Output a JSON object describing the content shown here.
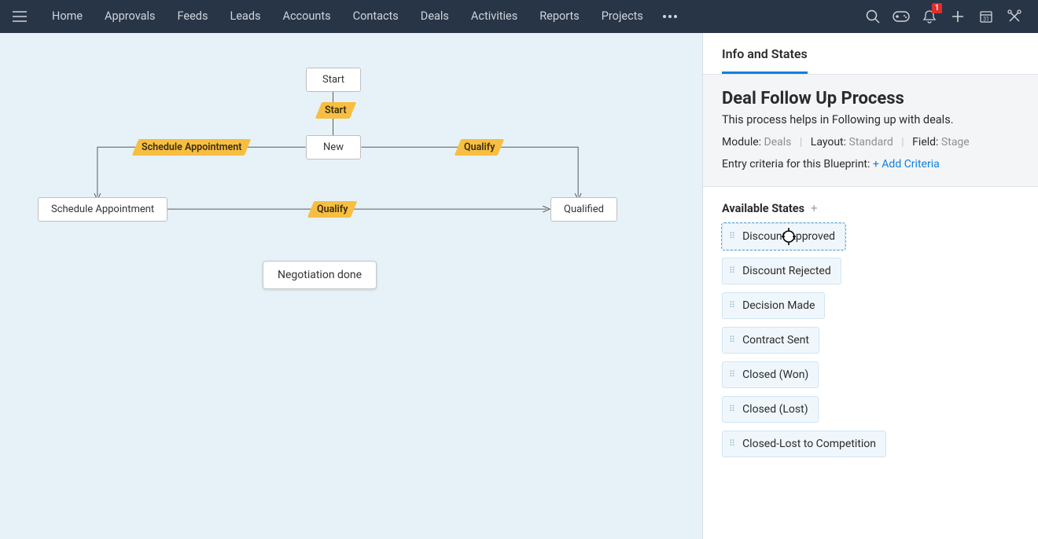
{
  "nav": {
    "items": [
      "Home",
      "Approvals",
      "Feeds",
      "Leads",
      "Accounts",
      "Contacts",
      "Deals",
      "Activities",
      "Reports",
      "Projects"
    ],
    "more_icon": "dots-horizontal-icon",
    "notification_count": "1"
  },
  "icons": {
    "search": "search-icon",
    "gamepad": "gamepad-icon",
    "bell": "bell-icon",
    "plus": "plus-icon",
    "calendar": "calendar-icon",
    "tools": "tools-icon"
  },
  "canvas": {
    "start_node": "Start",
    "start_trans": "Start",
    "new_node": "New",
    "schedule_trans": "Schedule Appointment",
    "qualify_trans_top": "Qualify",
    "schedule_node": "Schedule Appointment",
    "qualify_trans_mid": "Qualify",
    "qualified_node": "Qualified",
    "floating_chip": "Negotiation done"
  },
  "panel": {
    "tab": "Info and States",
    "title": "Deal Follow Up Process",
    "desc": "This process helps in Following up with deals.",
    "module_label": "Module:",
    "module_value": "Deals",
    "layout_label": "Layout:",
    "layout_value": "Standard",
    "field_label": "Field:",
    "field_value": "Stage",
    "criteria_label": "Entry criteria for this Blueprint: ",
    "criteria_link": "+ Add Criteria",
    "states_heading": "Available States",
    "states": [
      "Discount Approved",
      "Discount Rejected",
      "Decision Made",
      "Contract Sent",
      "Closed (Won)",
      "Closed (Lost)",
      "Closed-Lost to Competition"
    ]
  }
}
